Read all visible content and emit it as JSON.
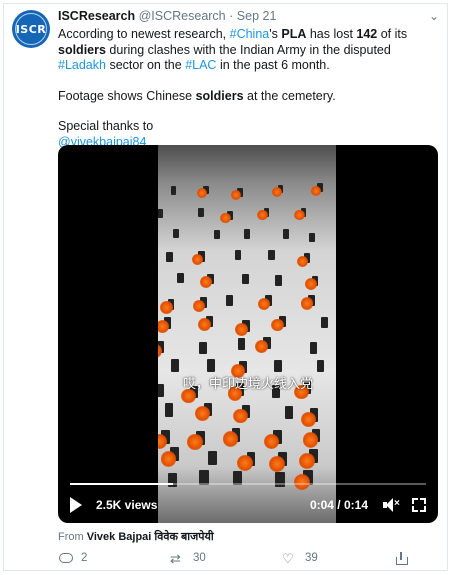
{
  "tweet": {
    "author_name": "ISCResearch",
    "handle": "@ISCResearch",
    "separator": "·",
    "date": "Sep 21",
    "avatar_text": "ISCR",
    "para1": {
      "t1": "According to newest research, ",
      "tag_china": "#China",
      "t2": "'s ",
      "b_pla": "PLA",
      "t3": " has lost ",
      "b_num": "142",
      "t4": " of its ",
      "b_soldiers": "soldiers",
      "t5": " during clashes with the Indian Army in the disputed ",
      "tag_ladakh": "#Ladakh",
      "t6": " sector on the ",
      "tag_lac": "#LAC",
      "t7": " in the past 6 month."
    },
    "para2": {
      "t1": "Footage shows Chinese ",
      "b_soldiers": "soldiers",
      "t2": " at the cemetery."
    },
    "para3": {
      "t1": "Special thanks to",
      "mention": "@vivekbajpai84"
    }
  },
  "video": {
    "subtitle": "哎，中印边境火线入党",
    "views": "2.5K views",
    "timer": "0:04 / 0:14",
    "progress": 0.29
  },
  "from": {
    "label": "From",
    "name": "Vivek Bajpai विवेक बाजपेयी"
  },
  "actions": {
    "reply_count": "2",
    "retweet_count": "30",
    "like_count": "39"
  },
  "icons": {
    "reply": "reply-icon",
    "retweet": "retweet-icon",
    "like": "heart-icon",
    "share": "share-icon",
    "caret": "chevron-down-icon",
    "play": "play-icon",
    "mute": "mute-icon",
    "fullscreen": "fullscreen-icon"
  },
  "colors": {
    "link": "#1b95e0",
    "muted": "#657786",
    "avatar_bg": "#1566b7"
  }
}
